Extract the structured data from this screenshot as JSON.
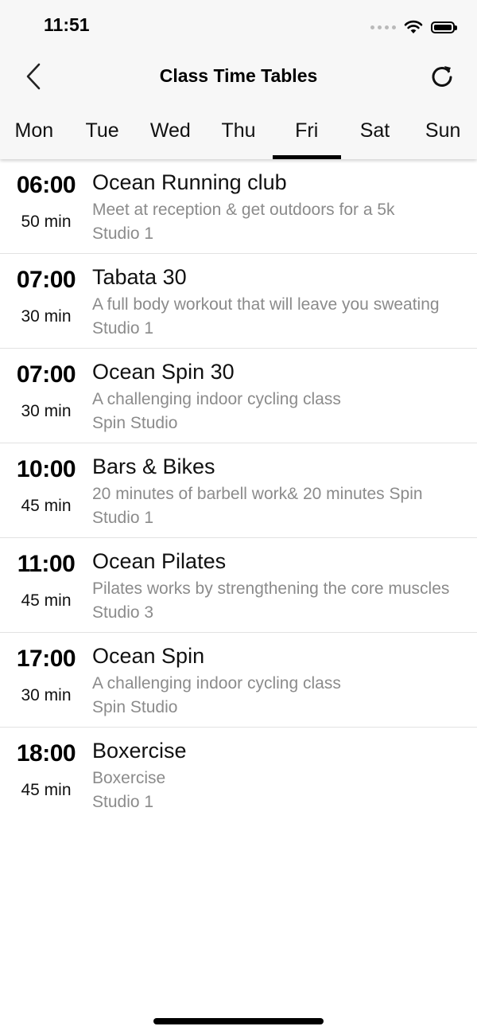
{
  "status_bar": {
    "time": "11:51"
  },
  "nav": {
    "title": "Class Time Tables",
    "back_icon": "chevron-left-icon",
    "refresh_icon": "refresh-icon"
  },
  "tabs": [
    {
      "label": "Mon",
      "active": false
    },
    {
      "label": "Tue",
      "active": false
    },
    {
      "label": "Wed",
      "active": false
    },
    {
      "label": "Thu",
      "active": false
    },
    {
      "label": "Fri",
      "active": true
    },
    {
      "label": "Sat",
      "active": false
    },
    {
      "label": "Sun",
      "active": false
    }
  ],
  "classes": [
    {
      "time": "06:00",
      "duration": "50 min",
      "name": "Ocean Running club",
      "description": "Meet at reception & get outdoors for a 5k",
      "studio": "Studio 1"
    },
    {
      "time": "07:00",
      "duration": "30 min",
      "name": "Tabata 30",
      "description": "A full body workout that will leave you sweating",
      "studio": "Studio 1"
    },
    {
      "time": "07:00",
      "duration": "30 min",
      "name": "Ocean Spin 30",
      "description": "A challenging indoor cycling class",
      "studio": "Spin Studio"
    },
    {
      "time": "10:00",
      "duration": "45 min",
      "name": "Bars & Bikes",
      "description": "20 minutes of barbell work& 20 minutes Spin",
      "studio": "Studio 1"
    },
    {
      "time": "11:00",
      "duration": "45 min",
      "name": "Ocean Pilates",
      "description": "Pilates works by strengthening the core muscles",
      "studio": "Studio 3"
    },
    {
      "time": "17:00",
      "duration": "30 min",
      "name": "Ocean Spin",
      "description": "A challenging indoor cycling class",
      "studio": "Spin Studio"
    },
    {
      "time": "18:00",
      "duration": "45 min",
      "name": "Boxercise",
      "description": "Boxercise",
      "studio": "Studio 1"
    }
  ],
  "colors": {
    "header_bg": "#f7f7f7",
    "active_indicator": "#000000",
    "secondary_text": "#8b8b8b"
  }
}
